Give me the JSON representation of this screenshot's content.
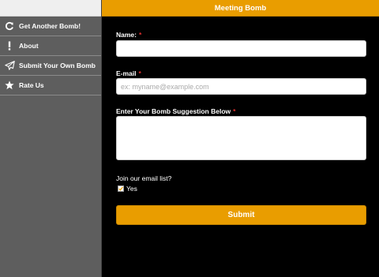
{
  "sidebar": {
    "items": [
      {
        "label": "Get Another Bomb!",
        "icon": "refresh-icon"
      },
      {
        "label": "About",
        "icon": "exclamation-icon"
      },
      {
        "label": "Submit Your Own Bomb",
        "icon": "paper-plane-icon"
      },
      {
        "label": "Rate Us",
        "icon": "star-icon"
      }
    ]
  },
  "header": {
    "title": "Meeting Bomb"
  },
  "form": {
    "name_label": "Name:",
    "name_required": "*",
    "name_value": "",
    "email_label": "E-mail",
    "email_required": "*",
    "email_placeholder": "ex: myname@example.com",
    "suggestion_label": "Enter Your Bomb Suggestion Below",
    "suggestion_required": "*",
    "suggestion_value": "",
    "optin_label": "Join our email list?",
    "optin_option": "Yes",
    "optin_checked": true,
    "submit_label": "Submit"
  },
  "colors": {
    "accent": "#e99d00",
    "sidebar": "#5e5e5e",
    "required": "#e0302f"
  }
}
